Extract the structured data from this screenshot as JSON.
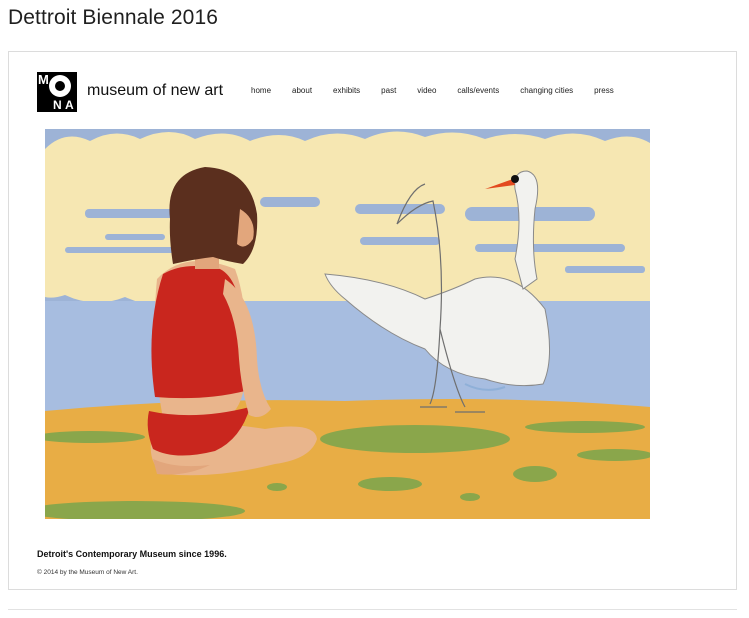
{
  "page": {
    "title": "Dettroit Biennale 2016"
  },
  "site": {
    "logo_letters": {
      "m": "M",
      "o": "O",
      "n": "N",
      "a": "A"
    },
    "brand_name": "museum of new art",
    "nav": [
      {
        "label": "home"
      },
      {
        "label": "about"
      },
      {
        "label": "exhibits"
      },
      {
        "label": "past"
      },
      {
        "label": "video"
      },
      {
        "label": "calls/events"
      },
      {
        "label": "changing cities"
      },
      {
        "label": "press"
      }
    ],
    "tagline": "Detroit's Contemporary Museum since 1996.",
    "copyright": "© 2014 by the Museum of New Art."
  },
  "artwork": {
    "subject": "woman in red swimsuit kneeling beside a swan on a beach",
    "colors": {
      "sky": "#9db3d6",
      "clouds": "#f6e7b2",
      "sea": "#a7bde0",
      "sand": "#e8ad45",
      "grass": "#8aa64b",
      "swimsuit": "#c9261e",
      "skin": "#e9b58c",
      "hair": "#5b2f1e"
    }
  }
}
